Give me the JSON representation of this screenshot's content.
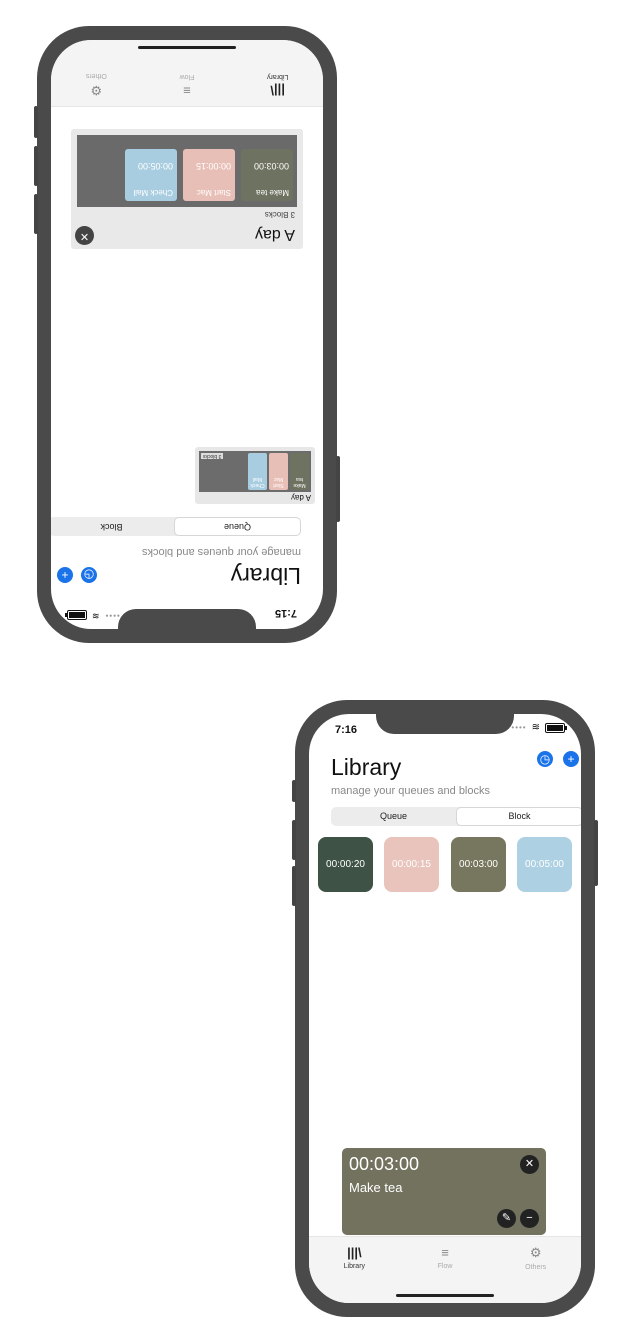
{
  "status": {
    "time_top": "7:15",
    "time_bottom": "7:16"
  },
  "header": {
    "title": "Library",
    "subtitle": "manage your queues and blocks"
  },
  "segments": {
    "queue": "Queue",
    "block": "Block"
  },
  "tabs": {
    "library": "Library",
    "flow": "Flow",
    "others": "Others"
  },
  "icons": {
    "library": "library-icon",
    "flow": "flow-icon",
    "others": "gear-icon",
    "timer": "timer-icon",
    "add": "plus-icon",
    "close": "close-icon",
    "edit": "pencil-icon",
    "remove": "minus-icon"
  },
  "queue": {
    "name": "A day",
    "count_label": "3 blocks",
    "count_label_detail": "3 Blocks",
    "mini_blocks": [
      "Make tea",
      "Start Mac",
      "Check Mail"
    ]
  },
  "detail_blocks": [
    {
      "name": "Make tea",
      "time": "00:03:00",
      "color": "#6e7260"
    },
    {
      "name": "Start Mac",
      "time": "00:00:15",
      "color": "#e8bfb6"
    },
    {
      "name": "Check Mail",
      "time": "00:05:00",
      "color": "#a9cde0"
    }
  ],
  "blocks": [
    {
      "time": "00:00:20",
      "color": "#3f5246"
    },
    {
      "time": "00:00:15",
      "color": "#e8c4bc"
    },
    {
      "time": "00:03:00",
      "color": "#77775f"
    },
    {
      "time": "00:05:00",
      "color": "#add0e2"
    }
  ],
  "active_block": {
    "time": "00:03:00",
    "name": "Make tea"
  },
  "colors": {
    "accent": "#1a73e8",
    "phone": "#4a4a4a"
  }
}
